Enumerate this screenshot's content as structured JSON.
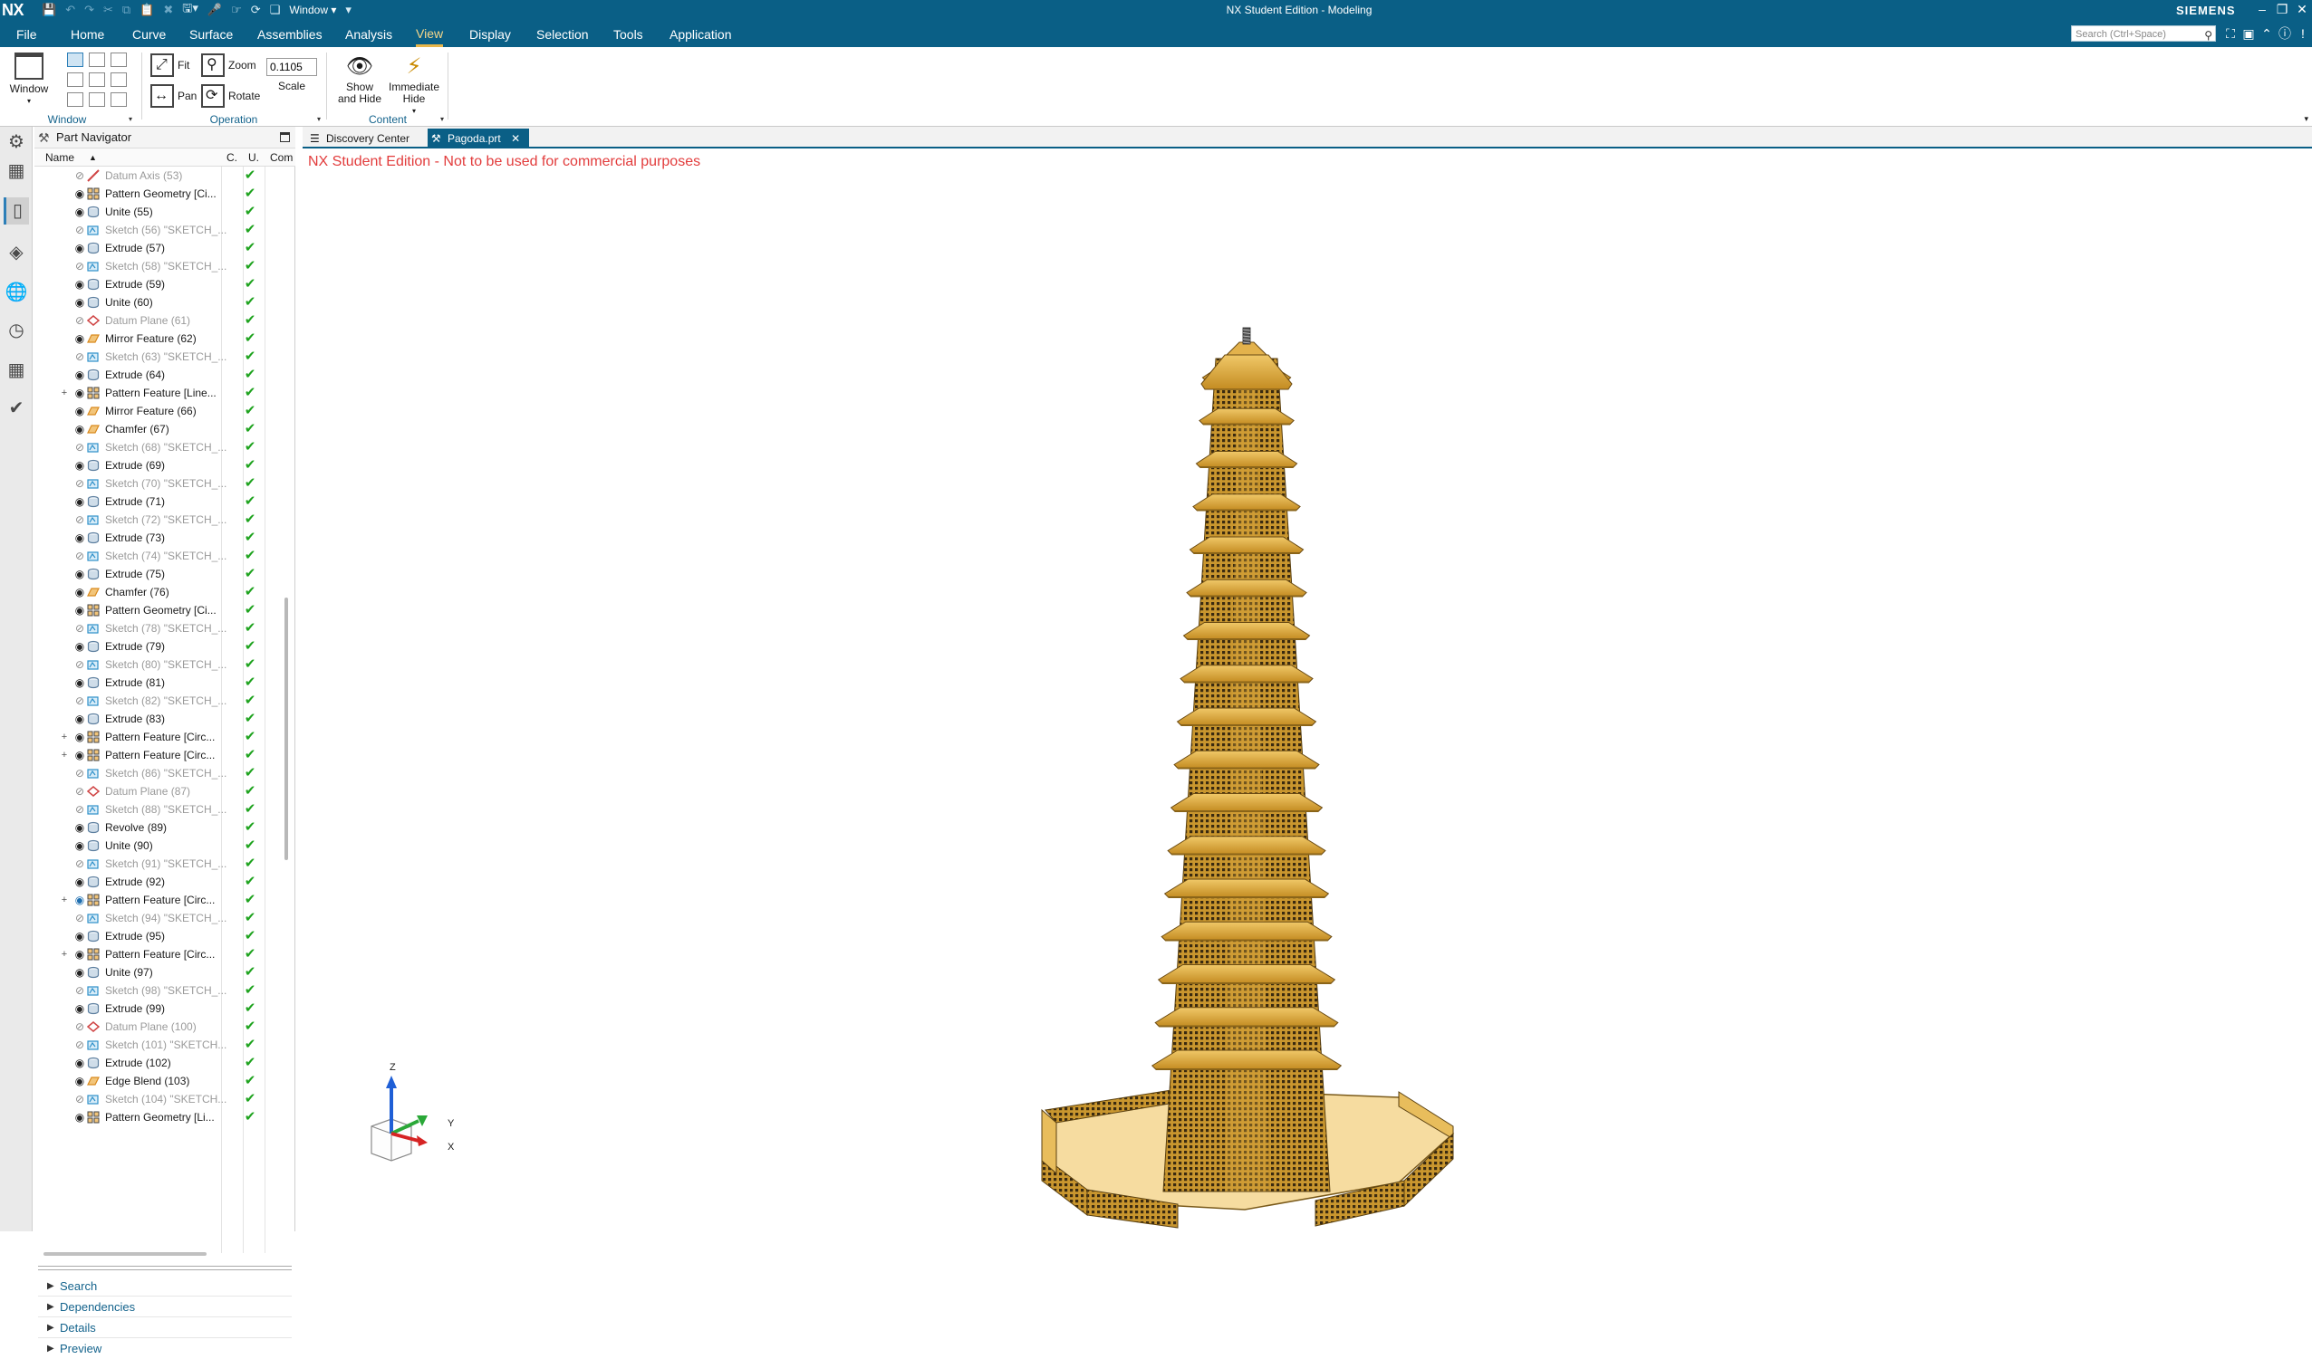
{
  "titlebar": {
    "logo": "NX",
    "window_menu": "Window",
    "title": "NX Student Edition - Modeling",
    "brand": "SIEMENS"
  },
  "menubar": {
    "tabs": [
      "File",
      "Home",
      "Curve",
      "Surface",
      "Assemblies",
      "Analysis",
      "View",
      "Display",
      "Selection",
      "Tools",
      "Application"
    ],
    "active_tab": "View",
    "search_placeholder": "Search (Ctrl+Space)"
  },
  "ribbon": {
    "window_group": {
      "button": "Window",
      "label": "Window"
    },
    "operation_group": {
      "fit": "Fit",
      "pan": "Pan",
      "zoom": "Zoom",
      "rotate": "Rotate",
      "scale_value": "0.1105",
      "scale_label": "Scale",
      "label": "Operation"
    },
    "content_group": {
      "show_hide_line1": "Show",
      "show_hide_line2": "and Hide",
      "immediate_line1": "Immediate",
      "immediate_line2": "Hide",
      "label": "Content"
    }
  },
  "navigator": {
    "title": "Part Navigator",
    "columns": {
      "name": "Name",
      "c": "C.",
      "u": "U.",
      "comment": "Com"
    },
    "features": [
      {
        "name": "Datum Axis (53)",
        "type": "datum-axis",
        "hidden": true,
        "expand": ""
      },
      {
        "name": "Pattern Geometry [Ci...",
        "type": "pattern",
        "hidden": false,
        "expand": ""
      },
      {
        "name": "Unite (55)",
        "type": "unite",
        "hidden": false,
        "expand": ""
      },
      {
        "name": "Sketch (56) \"SKETCH_...",
        "type": "sketch",
        "hidden": true,
        "expand": ""
      },
      {
        "name": "Extrude (57)",
        "type": "extrude",
        "hidden": false,
        "expand": ""
      },
      {
        "name": "Sketch (58) \"SKETCH_...",
        "type": "sketch",
        "hidden": true,
        "expand": ""
      },
      {
        "name": "Extrude (59)",
        "type": "extrude",
        "hidden": false,
        "expand": ""
      },
      {
        "name": "Unite (60)",
        "type": "unite",
        "hidden": false,
        "expand": ""
      },
      {
        "name": "Datum Plane (61)",
        "type": "datum-plane",
        "hidden": true,
        "expand": ""
      },
      {
        "name": "Mirror Feature (62)",
        "type": "mirror",
        "hidden": false,
        "expand": ""
      },
      {
        "name": "Sketch (63) \"SKETCH_...",
        "type": "sketch",
        "hidden": true,
        "expand": ""
      },
      {
        "name": "Extrude (64)",
        "type": "extrude",
        "hidden": false,
        "expand": ""
      },
      {
        "name": "Pattern Feature [Line...",
        "type": "pattern",
        "hidden": false,
        "expand": "+"
      },
      {
        "name": "Mirror Feature (66)",
        "type": "mirror",
        "hidden": false,
        "expand": ""
      },
      {
        "name": "Chamfer (67)",
        "type": "chamfer",
        "hidden": false,
        "expand": ""
      },
      {
        "name": "Sketch (68) \"SKETCH_...",
        "type": "sketch",
        "hidden": true,
        "expand": ""
      },
      {
        "name": "Extrude (69)",
        "type": "extrude",
        "hidden": false,
        "expand": ""
      },
      {
        "name": "Sketch (70) \"SKETCH_...",
        "type": "sketch",
        "hidden": true,
        "expand": ""
      },
      {
        "name": "Extrude (71)",
        "type": "extrude",
        "hidden": false,
        "expand": ""
      },
      {
        "name": "Sketch (72) \"SKETCH_...",
        "type": "sketch",
        "hidden": true,
        "expand": ""
      },
      {
        "name": "Extrude (73)",
        "type": "extrude",
        "hidden": false,
        "expand": ""
      },
      {
        "name": "Sketch (74) \"SKETCH_...",
        "type": "sketch",
        "hidden": true,
        "expand": ""
      },
      {
        "name": "Extrude (75)",
        "type": "extrude",
        "hidden": false,
        "expand": ""
      },
      {
        "name": "Chamfer (76)",
        "type": "chamfer",
        "hidden": false,
        "expand": ""
      },
      {
        "name": "Pattern Geometry [Ci...",
        "type": "pattern",
        "hidden": false,
        "expand": ""
      },
      {
        "name": "Sketch (78) \"SKETCH_...",
        "type": "sketch",
        "hidden": true,
        "expand": ""
      },
      {
        "name": "Extrude (79)",
        "type": "extrude",
        "hidden": false,
        "expand": ""
      },
      {
        "name": "Sketch (80) \"SKETCH_...",
        "type": "sketch",
        "hidden": true,
        "expand": ""
      },
      {
        "name": "Extrude (81)",
        "type": "extrude",
        "hidden": false,
        "expand": ""
      },
      {
        "name": "Sketch (82) \"SKETCH_...",
        "type": "sketch",
        "hidden": true,
        "expand": ""
      },
      {
        "name": "Extrude (83)",
        "type": "extrude",
        "hidden": false,
        "expand": ""
      },
      {
        "name": "Pattern Feature [Circ...",
        "type": "pattern",
        "hidden": false,
        "expand": "+"
      },
      {
        "name": "Pattern Feature [Circ...",
        "type": "pattern",
        "hidden": false,
        "expand": "+"
      },
      {
        "name": "Sketch (86) \"SKETCH_...",
        "type": "sketch",
        "hidden": true,
        "expand": ""
      },
      {
        "name": "Datum Plane (87)",
        "type": "datum-plane",
        "hidden": true,
        "expand": ""
      },
      {
        "name": "Sketch (88) \"SKETCH_...",
        "type": "sketch",
        "hidden": true,
        "expand": ""
      },
      {
        "name": "Revolve (89)",
        "type": "revolve",
        "hidden": false,
        "expand": ""
      },
      {
        "name": "Unite (90)",
        "type": "unite",
        "hidden": false,
        "expand": ""
      },
      {
        "name": "Sketch (91) \"SKETCH_...",
        "type": "sketch",
        "hidden": true,
        "expand": ""
      },
      {
        "name": "Extrude (92)",
        "type": "extrude",
        "hidden": false,
        "expand": ""
      },
      {
        "name": "Pattern Feature [Circ...",
        "type": "pattern",
        "hidden": false,
        "expand": "+",
        "current": true
      },
      {
        "name": "Sketch (94) \"SKETCH_...",
        "type": "sketch",
        "hidden": true,
        "expand": ""
      },
      {
        "name": "Extrude (95)",
        "type": "extrude",
        "hidden": false,
        "expand": ""
      },
      {
        "name": "Pattern Feature [Circ...",
        "type": "pattern",
        "hidden": false,
        "expand": "+"
      },
      {
        "name": "Unite (97)",
        "type": "unite",
        "hidden": false,
        "expand": ""
      },
      {
        "name": "Sketch (98) \"SKETCH_...",
        "type": "sketch",
        "hidden": true,
        "expand": ""
      },
      {
        "name": "Extrude (99)",
        "type": "extrude",
        "hidden": false,
        "expand": ""
      },
      {
        "name": "Datum Plane (100)",
        "type": "datum-plane",
        "hidden": true,
        "expand": ""
      },
      {
        "name": "Sketch (101) \"SKETCH...",
        "type": "sketch",
        "hidden": true,
        "expand": ""
      },
      {
        "name": "Extrude (102)",
        "type": "extrude",
        "hidden": false,
        "expand": ""
      },
      {
        "name": "Edge Blend (103)",
        "type": "blend",
        "hidden": false,
        "expand": ""
      },
      {
        "name": "Sketch (104) \"SKETCH...",
        "type": "sketch",
        "hidden": true,
        "expand": ""
      },
      {
        "name": "Pattern Geometry [Li...",
        "type": "pattern",
        "hidden": false,
        "expand": ""
      }
    ],
    "panels": [
      "Search",
      "Dependencies",
      "Details",
      "Preview"
    ]
  },
  "document_tabs": [
    {
      "label": "Discovery Center",
      "active": false
    },
    {
      "label": "Pagoda.prt",
      "active": true
    }
  ],
  "graphics": {
    "watermark": "NX Student Edition - Not to be used for commercial purposes",
    "triad": {
      "z": "Z",
      "y": "Y",
      "x": "X"
    },
    "model_color": "#d8a838"
  },
  "colors": {
    "titlebar": "#0a5f86",
    "accent_tab": "#e8b64a",
    "check_green": "#1fa31f",
    "watermark_red": "#e23c3c"
  }
}
